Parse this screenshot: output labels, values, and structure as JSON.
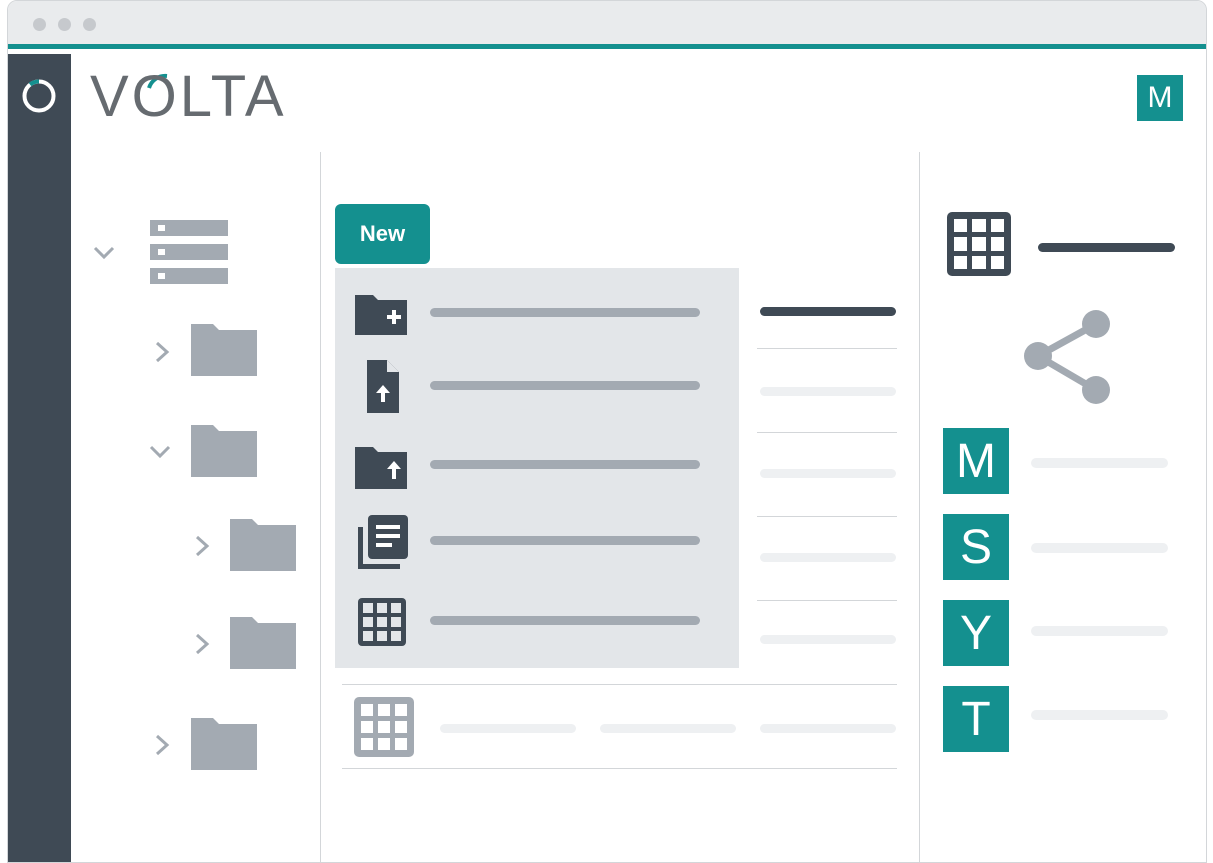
{
  "app": {
    "logo_text": "VOLTA",
    "user_initial": "M"
  },
  "toolbar": {
    "new_label": "New"
  },
  "new_menu": {
    "items": [
      {
        "icon": "folder-add-icon"
      },
      {
        "icon": "file-upload-icon"
      },
      {
        "icon": "folder-upload-icon"
      },
      {
        "icon": "document-stack-icon"
      },
      {
        "icon": "table-grid-icon"
      }
    ]
  },
  "tree": {
    "root_icon": "server-icon",
    "nodes": [
      {
        "icon": "folder-icon",
        "state": "collapsed"
      },
      {
        "icon": "folder-icon",
        "state": "expanded"
      },
      {
        "icon": "folder-icon",
        "state": "collapsed"
      },
      {
        "icon": "folder-icon",
        "state": "collapsed"
      },
      {
        "icon": "folder-icon",
        "state": "collapsed"
      }
    ]
  },
  "details": {
    "header_icon": "table-grid-icon",
    "share_icon": "share-icon",
    "members": [
      {
        "initial": "M"
      },
      {
        "initial": "S"
      },
      {
        "initial": "Y"
      },
      {
        "initial": "T"
      }
    ]
  },
  "colors": {
    "accent": "#14908f",
    "sidebar": "#3f4a55",
    "icon_dark": "#3f4a55",
    "icon_gray": "#a3aab2"
  }
}
